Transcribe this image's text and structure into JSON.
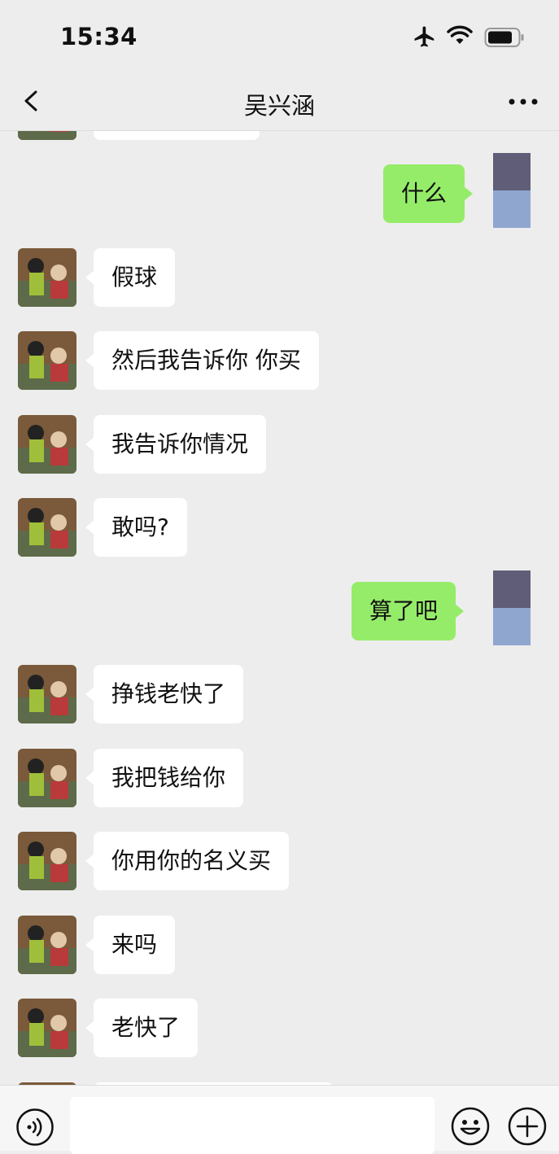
{
  "status_bar": {
    "time": "15:34",
    "icons": [
      "airplane-icon",
      "wifi-icon",
      "battery-icon"
    ]
  },
  "header": {
    "title": "吴兴涵",
    "back_icon": "chevron-left-icon",
    "more_icon": "more-dots-icon"
  },
  "messages": [
    {
      "from": "me",
      "text": "什么"
    },
    {
      "from": "contact",
      "text": "假球"
    },
    {
      "from": "contact",
      "text": "然后我告诉你 你买"
    },
    {
      "from": "contact",
      "text": "我告诉你情况"
    },
    {
      "from": "contact",
      "text": "敢吗?"
    },
    {
      "from": "me",
      "text": "算了吧"
    },
    {
      "from": "contact",
      "text": "挣钱老快了"
    },
    {
      "from": "contact",
      "text": "我把钱给你"
    },
    {
      "from": "contact",
      "text": "你用你的名义买"
    },
    {
      "from": "contact",
      "text": "来吗"
    },
    {
      "from": "contact",
      "text": "老快了"
    }
  ],
  "input_bar": {
    "value": "",
    "icons": [
      "voice-icon",
      "emoji-icon",
      "plus-icon"
    ]
  },
  "colors": {
    "background": "#ededed",
    "outgoing_bubble": "#95ec69",
    "incoming_bubble": "#ffffff",
    "text": "#111111"
  }
}
